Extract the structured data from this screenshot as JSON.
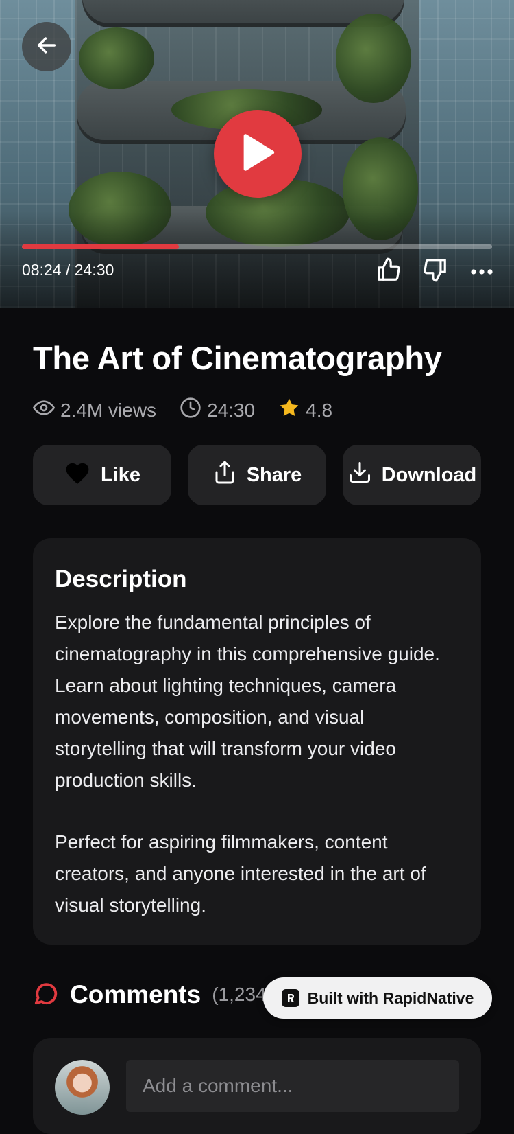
{
  "player": {
    "current_time": "08:24",
    "duration": "24:30",
    "time_display": "08:24 / 24:30",
    "progress_fraction": 0.334,
    "icons": {
      "back": "arrow-left-icon",
      "play": "play-icon",
      "like": "thumbs-up-icon",
      "dislike": "thumbs-down-icon",
      "more": "more-horizontal-icon"
    }
  },
  "video": {
    "title": "The Art of Cinematography",
    "views": "2.4M views",
    "duration": "24:30",
    "rating": "4.8"
  },
  "actions": {
    "like_label": "Like",
    "share_label": "Share",
    "download_label": "Download"
  },
  "description": {
    "heading": "Description",
    "paragraphs": [
      "Explore the fundamental principles of cinematography in this comprehensive guide. Learn about lighting techniques, camera movements, composition, and visual storytelling that will transform your video production skills.",
      "Perfect for aspiring filmmakers, content creators, and anyone interested in the art of visual storytelling."
    ]
  },
  "comments": {
    "title": "Comments",
    "count": "(1,234)",
    "input_placeholder": "Add a comment..."
  },
  "badge": {
    "label": "Built with RapidNative"
  },
  "colors": {
    "accent": "#e13a40",
    "background": "#0b0b0d",
    "card": "#19191b",
    "button": "#232325",
    "star": "#f5b81e"
  }
}
